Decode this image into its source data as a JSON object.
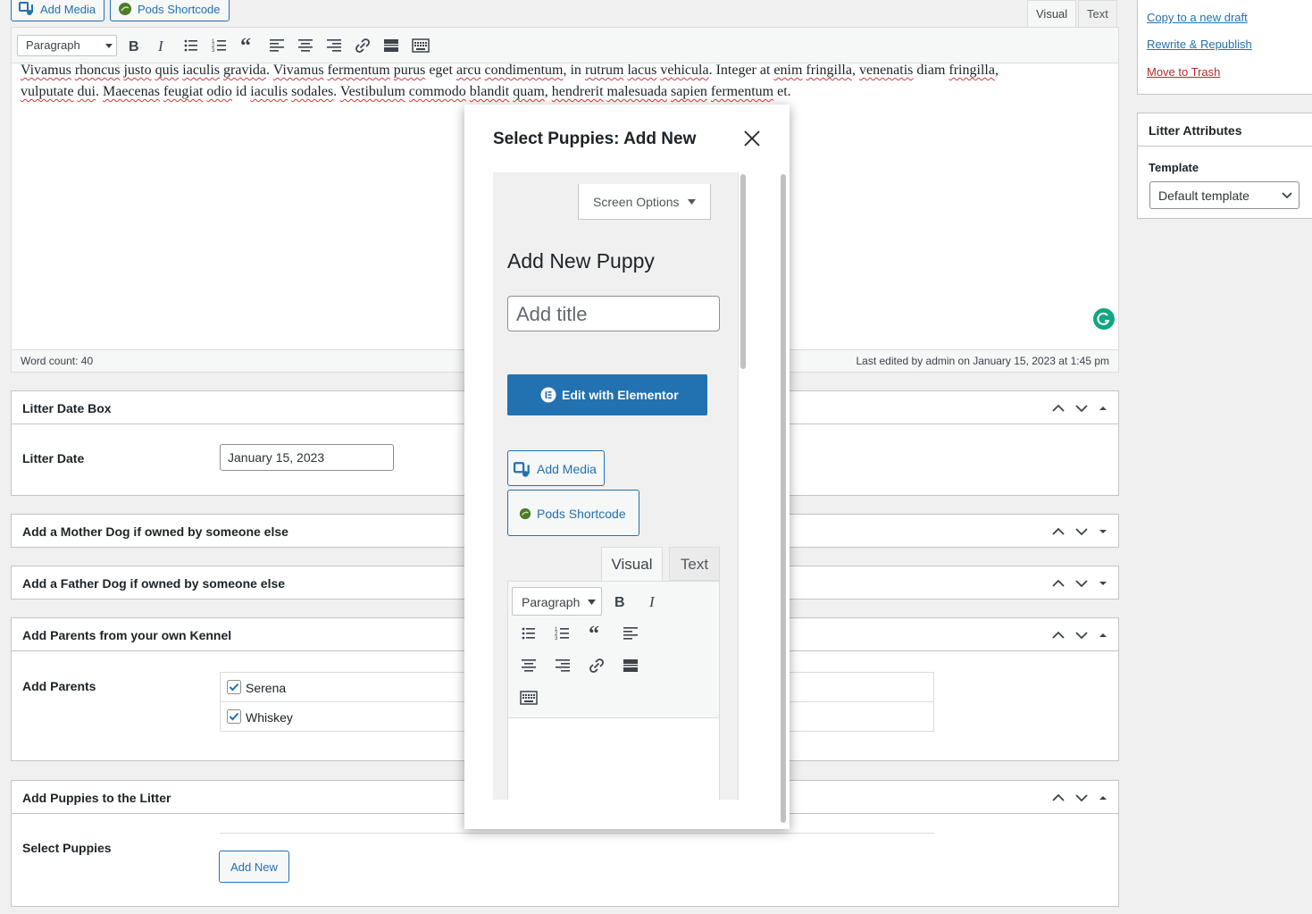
{
  "media_buttons": {
    "add_media": "Add Media",
    "pods_shortcode": "Pods Shortcode"
  },
  "editor_tabs": {
    "visual": "Visual",
    "text": "Text"
  },
  "toolbar": {
    "format": "Paragraph"
  },
  "editor": {
    "line1": [
      "Vivamus",
      " ",
      "rhoncus",
      " ",
      "justo",
      " ",
      "quis",
      " ",
      "iaculis",
      " ",
      "gravida",
      ". ",
      "Vivamus",
      " ",
      "fermentum",
      " ",
      "purus",
      " eget ",
      "arcu",
      " ",
      "condimentum",
      ", in ",
      "rutrum",
      " ",
      "lacus",
      " ",
      "vehicula",
      ". Integer at ",
      "enim",
      " ",
      "fringilla",
      ", ",
      "venenatis",
      " diam ",
      "fringilla",
      ","
    ],
    "line2": [
      "vulputate",
      " ",
      "dui",
      ". ",
      "Maecenas",
      " ",
      "feugiat",
      " ",
      "odio",
      " id ",
      "iaculis",
      " ",
      "sodales",
      ". ",
      "Vestibulum",
      " ",
      "commodo",
      " ",
      "blandit",
      " ",
      "quam",
      ", ",
      "hendrerit",
      " ",
      "malesuada",
      " ",
      "sapien",
      " ",
      "fermentum",
      " et."
    ],
    "word_count": "Word count: 40",
    "last_edited": "Last edited by admin on January 15, 2023 at 1:45 pm"
  },
  "boxes": {
    "litter_date": {
      "title": "Litter Date Box",
      "label": "Litter Date",
      "value": "January 15, 2023"
    },
    "mother": {
      "title": "Add a Mother Dog if owned by someone else"
    },
    "father": {
      "title": "Add a Father Dog if owned by someone else"
    },
    "parents": {
      "title": "Add Parents from your own Kennel",
      "label": "Add Parents",
      "options": [
        "Serena",
        "Whiskey"
      ]
    },
    "puppies": {
      "title": "Add Puppies to the Litter",
      "label": "Select Puppies",
      "add_new": "Add New"
    }
  },
  "sidebar": {
    "copy_draft": "Copy to a new draft",
    "rewrite": "Rewrite & Republish",
    "trash": "Move to Trash",
    "attributes_title": "Litter Attributes",
    "template_label": "Template",
    "template_value": "Default template"
  },
  "modal": {
    "title": "Select Puppies: Add New",
    "screen_options": "Screen Options",
    "heading": "Add New Puppy",
    "title_placeholder": "Add title",
    "elementor": "Edit with Elementor",
    "add_media": "Add Media",
    "pods_shortcode": "Pods Shortcode",
    "tab_visual": "Visual",
    "tab_text": "Text",
    "format": "Paragraph"
  },
  "colors": {
    "accent": "#2271b1",
    "trash": "#b32d2e",
    "grammarly": "#11a683",
    "pods": "#4a7c2a"
  }
}
